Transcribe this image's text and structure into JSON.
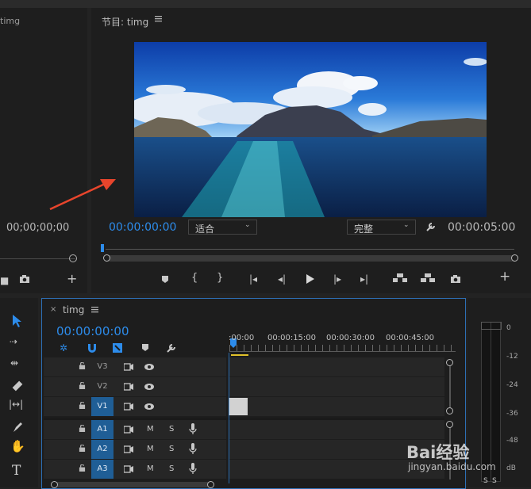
{
  "source_monitor": {
    "name": "timg",
    "timecode": "00;00;00;00"
  },
  "program_monitor": {
    "title": "节目: timg",
    "menu_icon": "hamburger-icon",
    "timecode_left": "00:00:00:00",
    "fit_value": "适合",
    "quality_value": "完整",
    "timecode_right": "00:00:05:00",
    "transport": [
      "marker-icon",
      "mark-in-icon",
      "mark-out-icon",
      "go-to-in-icon",
      "step-back-icon",
      "play-icon",
      "step-forward-icon",
      "go-to-out-icon",
      "lift-icon",
      "extract-icon",
      "export-frame-icon",
      "add-icon"
    ]
  },
  "tools": [
    "selection-tool-icon",
    "track-select-icon",
    "ripple-edit-icon",
    "razor-icon",
    "slip-icon",
    "pen-icon",
    "hand-icon",
    "type-tool-icon"
  ],
  "timeline": {
    "tab_close": "×",
    "sequence_name": "timg",
    "timecode": "00:00:00:00",
    "ruler": [
      ":00:00",
      "00:00:15:00",
      "00:00:30:00",
      "00:00:45:00"
    ],
    "video_tracks": [
      "V3",
      "V2",
      "V1"
    ],
    "audio_tracks": [
      "A1",
      "A2",
      "A3"
    ],
    "mute_label": "M",
    "solo_label": "S"
  },
  "audio_meter": {
    "labels": [
      "0",
      "-12",
      "-24",
      "-36",
      "-48",
      "dB"
    ],
    "solo": [
      "S",
      "S"
    ]
  },
  "watermark": {
    "brand": "Bai经验",
    "url": "jingyan.baidu.com"
  }
}
